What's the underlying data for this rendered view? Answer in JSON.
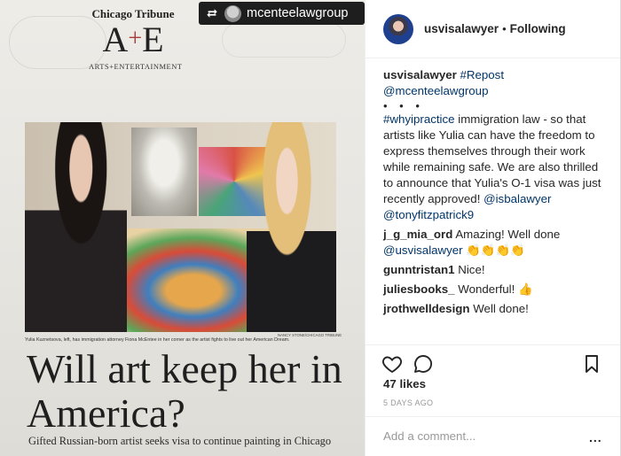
{
  "newspaper": {
    "paper_name": "Chicago Tribune",
    "section_logo": "A+E",
    "section_subtitle": "ARTS+ENTERTAINMENT",
    "photo_credit": "NANCY STONE/CHICAGO TRIBUNE",
    "photo_caption": "Yulia Kuznetsova, left, has immigration attorney Fiona McEntee in her corner as the artist fights to live out her American Dream.",
    "headline": "Will art keep her in America?",
    "subheadline": "Gifted Russian-born artist seeks visa to continue painting in Chicago"
  },
  "repost_badge": {
    "username": "mcenteelawgroup",
    "icon": "repost-icon"
  },
  "post_header": {
    "author": "usvisalawyer",
    "separator": "•",
    "follow_status": "Following"
  },
  "caption": {
    "author": "usvisalawyer",
    "hashtag_repost": "#Repost",
    "mention_source": "@mcenteelawgroup",
    "ellipsis": "• • •",
    "hashtag_why": "#whyipractice",
    "body_1": " immigration law - so that artists like Yulia can have the freedom to express themselves through their work while remaining safe. We are also thrilled to announce that Yulia's O-1 visa was just recently approved! ",
    "mention_1": "@isbalawyer",
    "mention_2": "@tonyfitzpatrick9"
  },
  "comments": [
    {
      "user": "j_g_mia_ord",
      "text": "Amazing! Well done",
      "mention": "@usvisalawyer",
      "emoji": "👏👏👏👏"
    },
    {
      "user": "gunntristan1",
      "text": "Nice!"
    },
    {
      "user": "juliesbooks_",
      "text": "Wonderful!",
      "emoji": "👍"
    },
    {
      "user": "jrothwelldesign",
      "text": "Well done!"
    }
  ],
  "actions": {
    "like_icon": "heart-icon",
    "comment_icon": "comment-bubble-icon",
    "save_icon": "bookmark-icon",
    "likes": "47 likes",
    "timestamp": "5 DAYS AGO",
    "comment_placeholder": "Add a comment...",
    "more_options": "..."
  }
}
